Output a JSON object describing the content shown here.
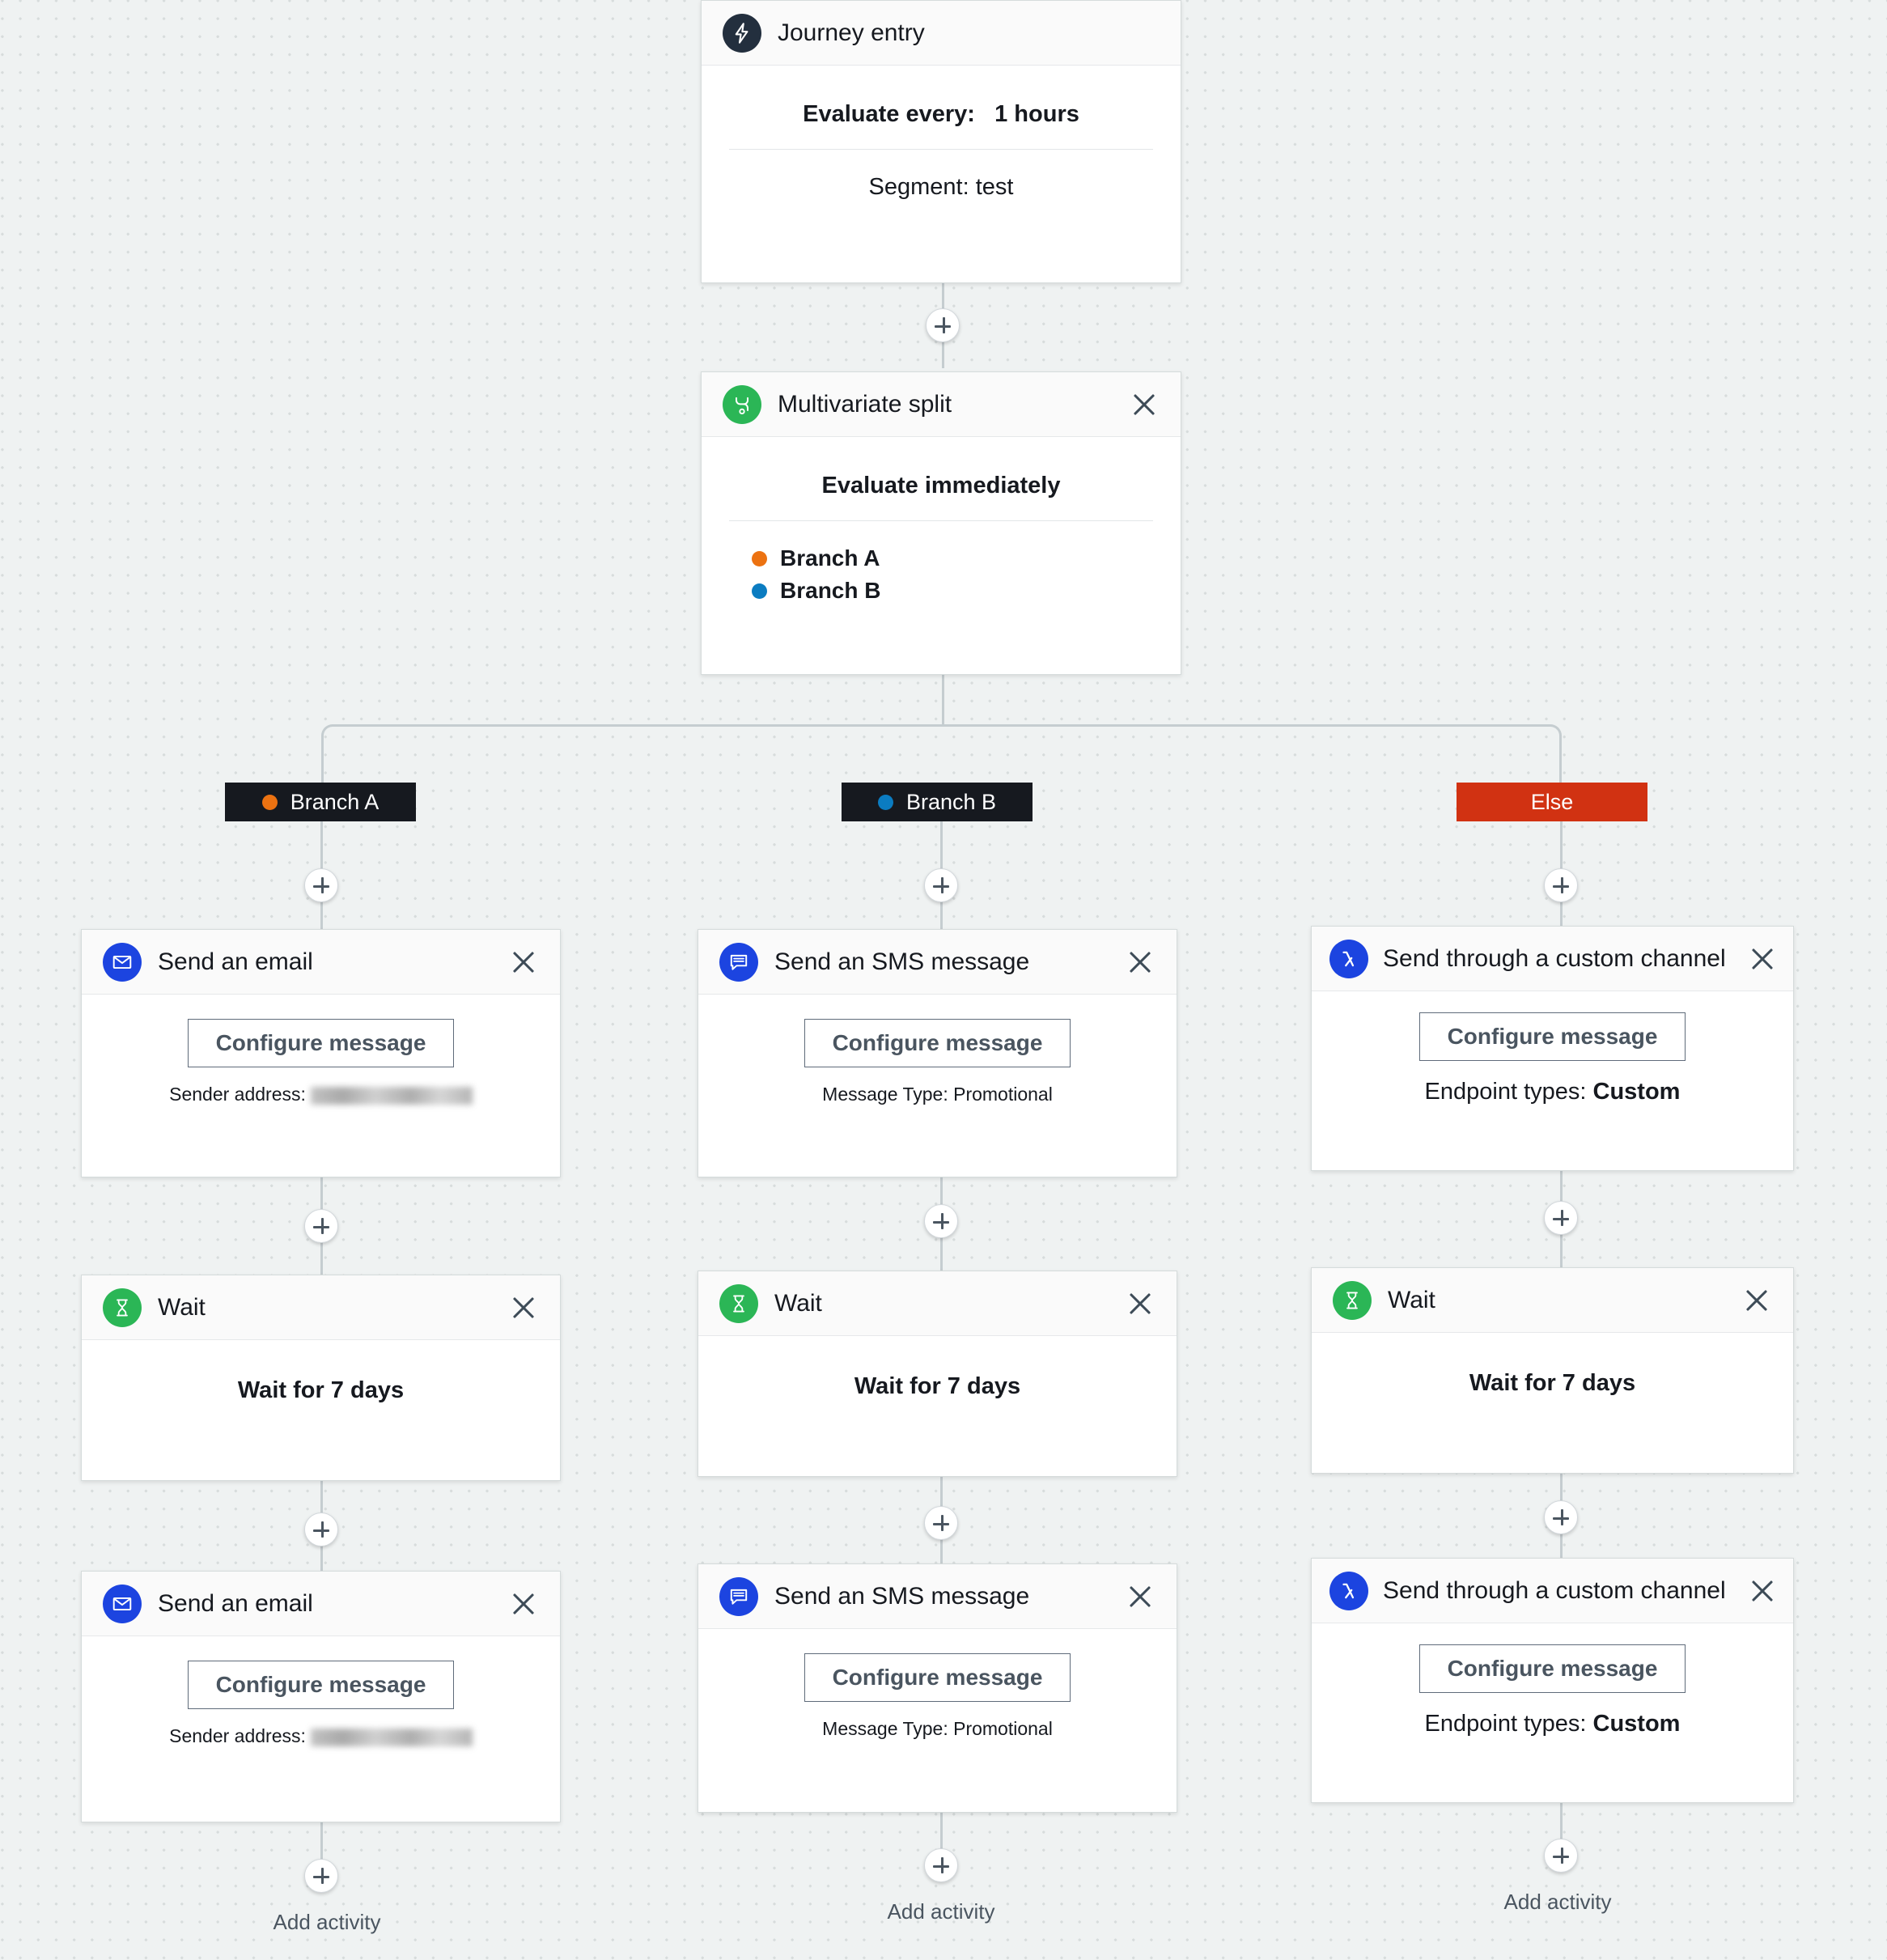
{
  "colors": {
    "canvas_bg": "#eff2f2",
    "dot": "#d7dcdc",
    "connector": "#c5cdd0",
    "entry_icon": "#232f3e",
    "split_icon": "#2bb656",
    "wait_icon": "#2bb656",
    "email_icon": "#1c44e0",
    "sms_icon": "#1c44e0",
    "custom_icon": "#1c44e0",
    "branch_a_dot": "#ec7211",
    "branch_b_dot": "#0b7cc1",
    "branch_pill_bg": "#16191f",
    "else_pill_bg": "#d13212"
  },
  "entry": {
    "title": "Journey entry",
    "icon": "lightning-bolt-icon",
    "evaluate_label": "Evaluate every:",
    "evaluate_value": "1 hours",
    "segment": "Segment: test"
  },
  "split": {
    "title": "Multivariate split",
    "icon": "split-fork-icon",
    "close_icon": "close-icon",
    "evaluate": "Evaluate immediately",
    "branches": [
      {
        "label": "Branch A",
        "color": "#ec7211"
      },
      {
        "label": "Branch B",
        "color": "#0b7cc1"
      }
    ]
  },
  "branch_pills": [
    {
      "label": "Branch A",
      "dot": "#ec7211",
      "bg": "#16191f"
    },
    {
      "label": "Branch B",
      "dot": "#0b7cc1",
      "bg": "#16191f"
    },
    {
      "label": "Else",
      "dot": null,
      "bg": "#d13212"
    }
  ],
  "cards": {
    "email": {
      "title": "Send an email",
      "icon": "envelope-icon",
      "close_icon": "close-icon",
      "button": "Configure message",
      "note_label": "Sender address:",
      "note_value": ""
    },
    "sms": {
      "title": "Send an SMS message",
      "icon": "chat-bubble-icon",
      "close_icon": "close-icon",
      "button": "Configure message",
      "note": "Message Type: Promotional"
    },
    "custom": {
      "title": "Send through a custom channel",
      "icon": "lambda-icon",
      "close_icon": "close-icon",
      "button": "Configure message",
      "note_label": "Endpoint types:",
      "note_value": "Custom"
    },
    "wait": {
      "title": "Wait",
      "icon": "hourglass-icon",
      "close_icon": "close-icon",
      "body": "Wait for 7 days"
    }
  },
  "add_activity": {
    "label": "Add activity",
    "icon": "plus-icon"
  }
}
